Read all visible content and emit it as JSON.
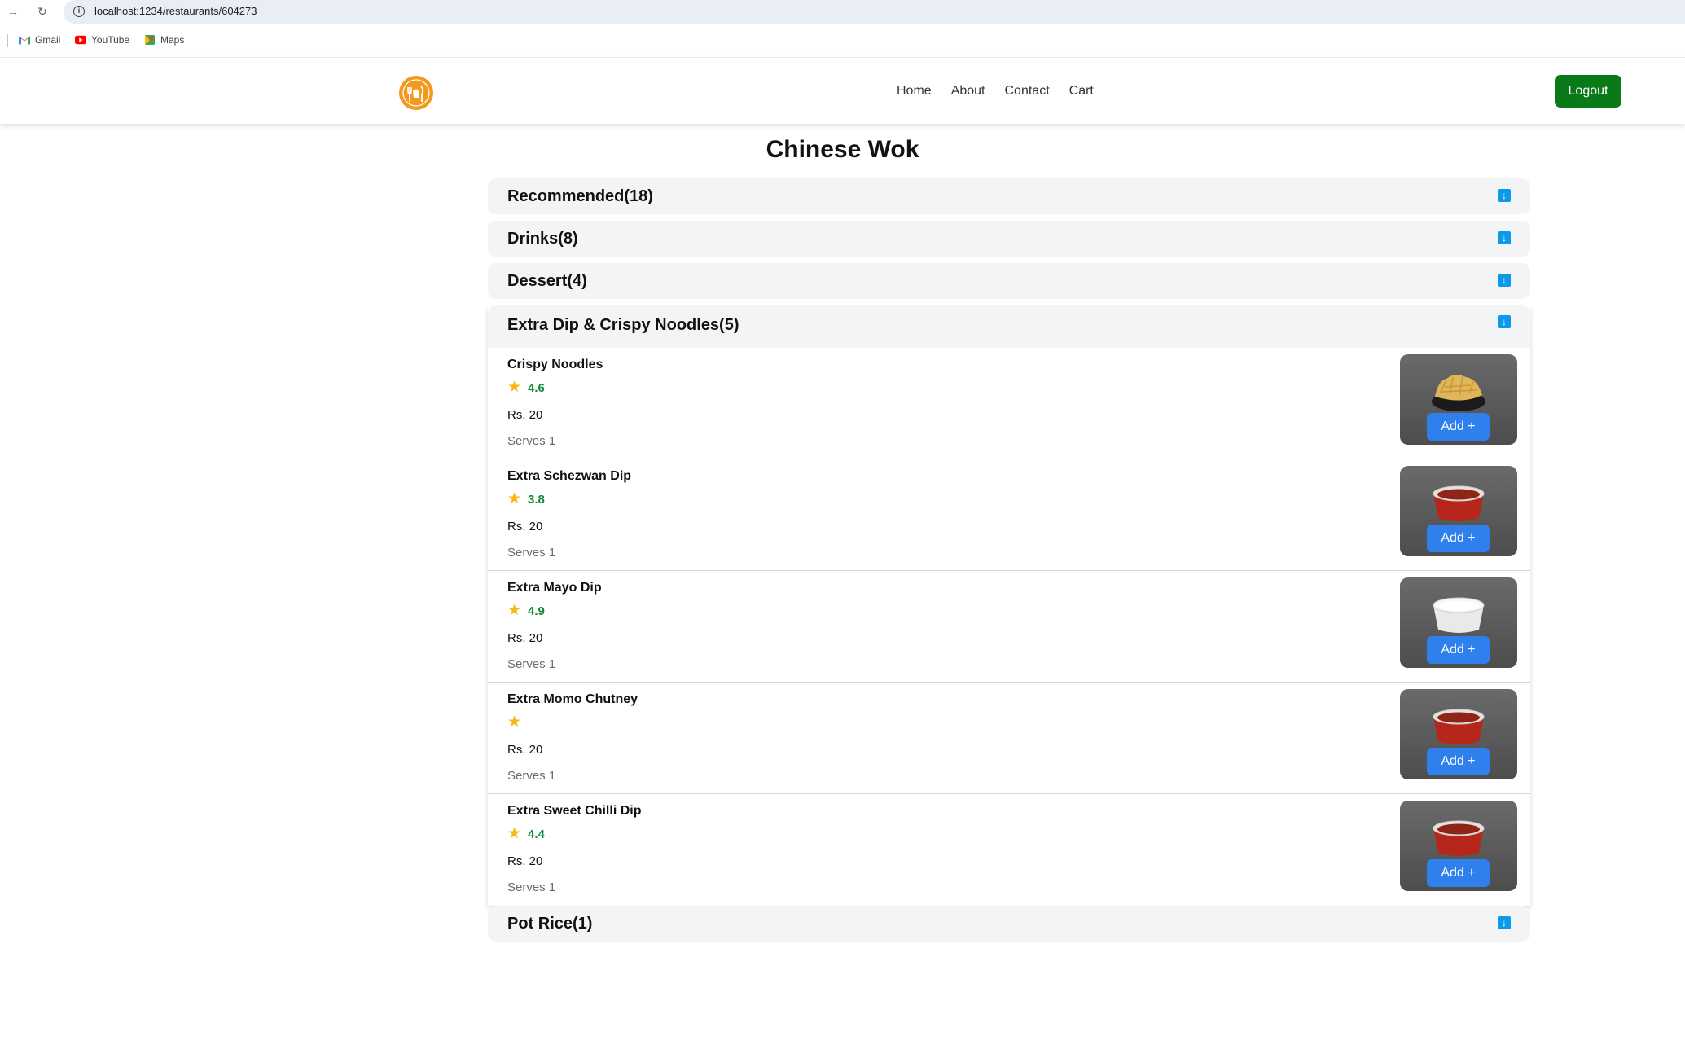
{
  "browser": {
    "url": "localhost:1234/restaurants/604273",
    "bookmarks": [
      {
        "label": "Gmail",
        "icon": "gmail-icon"
      },
      {
        "label": "YouTube",
        "icon": "youtube-icon"
      },
      {
        "label": "Maps",
        "icon": "maps-icon"
      }
    ]
  },
  "header": {
    "nav": [
      "Home",
      "About",
      "Contact",
      "Cart"
    ],
    "logout_label": "Logout"
  },
  "restaurant": {
    "name": "Chinese Wok"
  },
  "categories": [
    {
      "title": "Recommended(18)",
      "open": false
    },
    {
      "title": "Drinks(8)",
      "open": false
    },
    {
      "title": "Dessert(4)",
      "open": false
    },
    {
      "title": "Extra Dip & Crispy Noodles(5)",
      "open": true
    },
    {
      "title": "Pot Rice(1)",
      "open": false
    }
  ],
  "open_items": [
    {
      "name": "Crispy Noodles",
      "rating": "4.6",
      "price": "Rs. 20",
      "serves": "Serves 1",
      "add_label": "Add +",
      "food": "noodles"
    },
    {
      "name": "Extra Schezwan Dip",
      "rating": "3.8",
      "price": "Rs. 20",
      "serves": "Serves 1",
      "add_label": "Add +",
      "food": "red-dip"
    },
    {
      "name": "Extra Mayo Dip",
      "rating": "4.9",
      "price": "Rs. 20",
      "serves": "Serves 1",
      "add_label": "Add +",
      "food": "mayo"
    },
    {
      "name": "Extra Momo Chutney",
      "rating": "",
      "price": "Rs. 20",
      "serves": "Serves 1",
      "add_label": "Add +",
      "food": "red-dip"
    },
    {
      "name": "Extra Sweet Chilli Dip",
      "rating": "4.4",
      "price": "Rs. 20",
      "serves": "Serves 1",
      "add_label": "Add +",
      "food": "red-dip"
    }
  ],
  "colors": {
    "logout": "#0a7a19",
    "add_button": "#2f80ed",
    "rating": "#128a3a",
    "star": "#f5b914",
    "accordion_arrow": "#0d99ea",
    "logo": "#f39a1e"
  }
}
